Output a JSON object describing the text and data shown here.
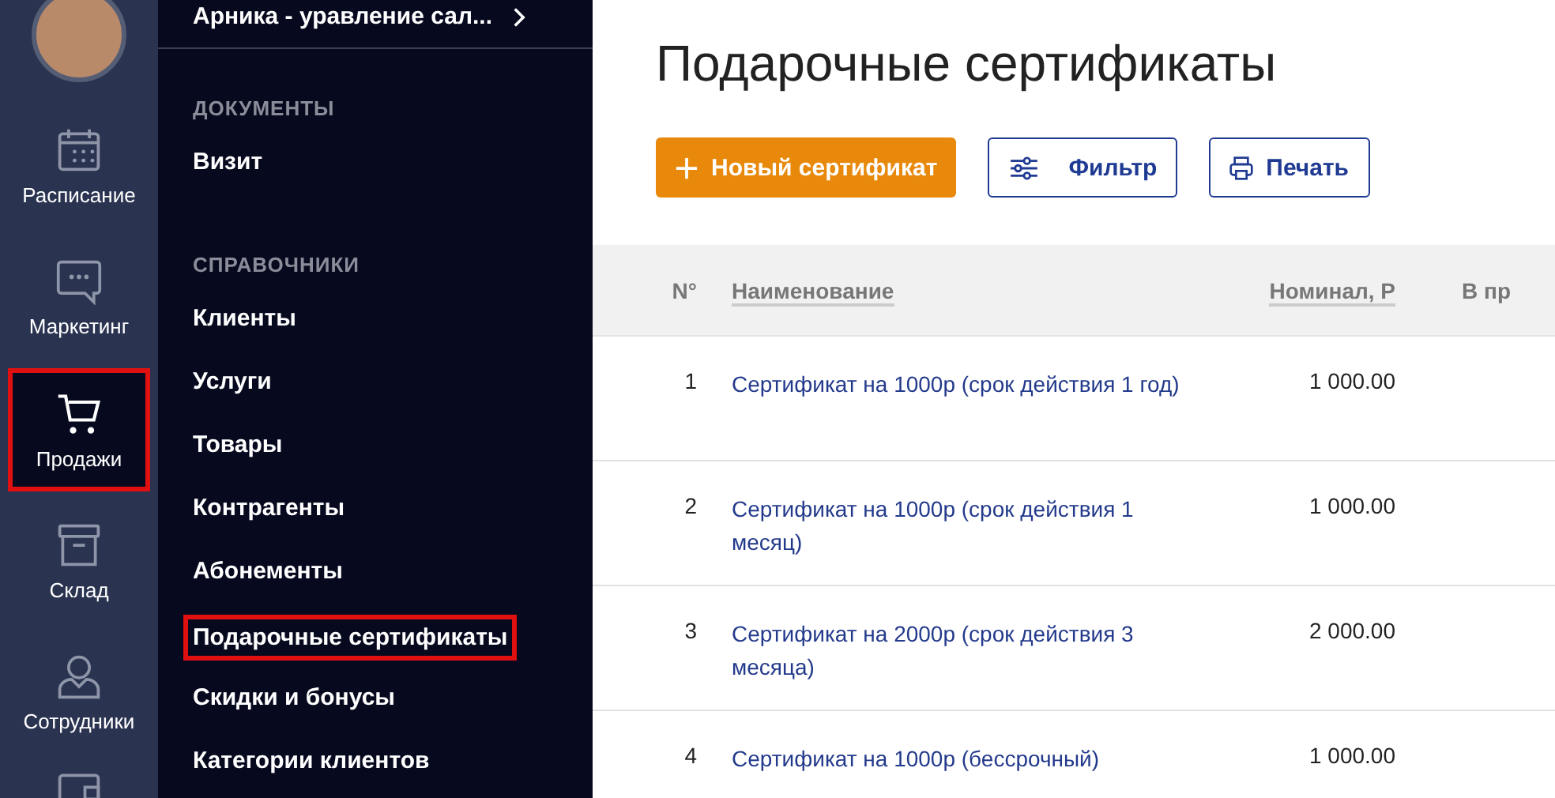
{
  "rail": {
    "items": [
      {
        "label": "Расписание",
        "kind": "calendar",
        "selected": false,
        "highlighted": false
      },
      {
        "label": "Маркетинг",
        "kind": "chat",
        "selected": false,
        "highlighted": false
      },
      {
        "label": "Продажи",
        "kind": "cart",
        "selected": true,
        "highlighted": true
      },
      {
        "label": "Склад",
        "kind": "box",
        "selected": false,
        "highlighted": false
      },
      {
        "label": "Сотрудники",
        "kind": "person",
        "selected": false,
        "highlighted": false
      }
    ]
  },
  "submenu": {
    "title": "Арника - уравление сал...",
    "sections": [
      {
        "heading": "ДОКУМЕНТЫ",
        "items": [
          {
            "label": "Визит",
            "highlighted": false
          }
        ]
      },
      {
        "heading": "СПРАВОЧНИКИ",
        "items": [
          {
            "label": "Клиенты",
            "highlighted": false
          },
          {
            "label": "Услуги",
            "highlighted": false
          },
          {
            "label": "Товары",
            "highlighted": false
          },
          {
            "label": "Контрагенты",
            "highlighted": false
          },
          {
            "label": "Абонементы",
            "highlighted": false
          },
          {
            "label": "Подарочные сертификаты",
            "highlighted": true
          },
          {
            "label": "Скидки и бонусы",
            "highlighted": false
          },
          {
            "label": "Категории клиентов",
            "highlighted": false
          }
        ]
      }
    ]
  },
  "page": {
    "title": "Подарочные сертификаты",
    "buttons": [
      {
        "label": "Новый сертификат",
        "kind": "primary"
      },
      {
        "label": "Фильтр",
        "kind": "filter"
      },
      {
        "label": "Печать",
        "kind": "print"
      }
    ]
  },
  "table": {
    "columns": [
      "N°",
      "Наименование",
      "Номинал, Р",
      "В пр"
    ],
    "rows": [
      {
        "number": "1",
        "name": "Сертификат на 1000р (срок действия 1 год)",
        "nominal": "1 000.00"
      },
      {
        "number": "2",
        "name": "Сертификат на 1000р (срок действия 1 месяц)",
        "nominal": "1 000.00"
      },
      {
        "number": "3",
        "name": "Сертификат на 2000р (срок действия 3 месяца)",
        "nominal": "2 000.00"
      },
      {
        "number": "4",
        "name": "Сертификат на 1000р (бессрочный)",
        "nominal": "1 000.00"
      }
    ]
  }
}
